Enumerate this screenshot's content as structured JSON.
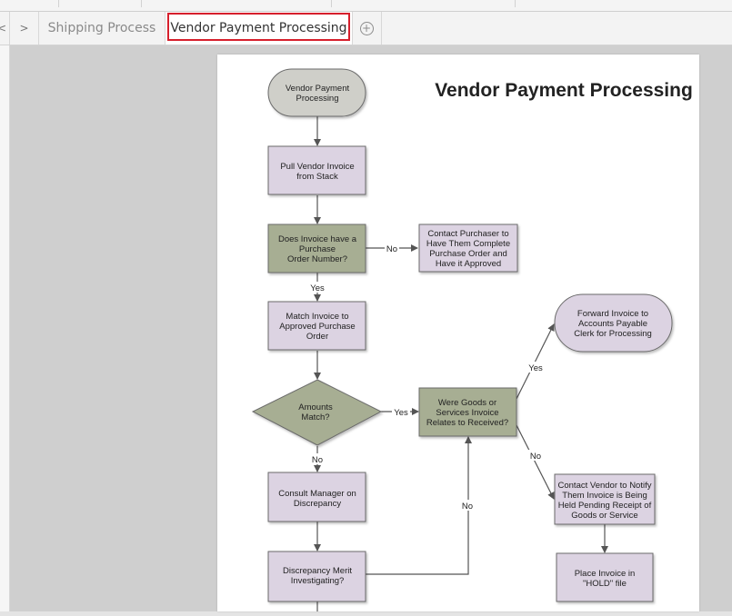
{
  "tabs": {
    "prev_label": "<",
    "next_label": ">",
    "items": [
      {
        "label": "Shipping Process",
        "active": false
      },
      {
        "label": "Vendor Payment Processing",
        "active": true
      }
    ],
    "add_label": "+"
  },
  "diagram": {
    "title": "Vendor Payment Processing",
    "nodes": {
      "start": [
        "Vendor Payment",
        "Processing"
      ],
      "pull": [
        "Pull Vendor Invoice",
        "from Stack"
      ],
      "has_po": [
        "Does Invoice have a",
        "Purchase",
        "Order Number?"
      ],
      "contact_purchaser": [
        "Contact Purchaser to",
        "Have Them Complete",
        "Purchase Order and",
        "Have it Approved"
      ],
      "match": [
        "Match Invoice to",
        "Approved Purchase",
        "Order"
      ],
      "amounts": [
        "Amounts",
        "Match?"
      ],
      "goods": [
        "Were Goods or",
        "Services Invoice",
        "Relates to Received?"
      ],
      "forward": [
        "Forward Invoice to",
        "Accounts Payable",
        "Clerk for Processing"
      ],
      "consult": [
        "Consult Manager on",
        "Discrepancy"
      ],
      "contact_vendor": [
        "Contact Vendor to Notify",
        "Them Invoice is Being",
        "Held Pending Receipt of",
        "Goods or Service"
      ],
      "merit": [
        "Discrepancy Merit",
        "Investigating?"
      ],
      "hold": [
        "Place Invoice in",
        "\"HOLD\" file"
      ]
    },
    "edge_labels": {
      "po_no": "No",
      "po_yes": "Yes",
      "amounts_yes": "Yes",
      "amounts_no": "No",
      "goods_yes": "Yes",
      "goods_no": "No",
      "merit_no": "No"
    },
    "colors": {
      "process_fill": "#dcd3e2",
      "decision_fill": "#a7ae93",
      "terminal_fill": "#cfcfc9",
      "stroke": "#6b6b6b"
    }
  }
}
